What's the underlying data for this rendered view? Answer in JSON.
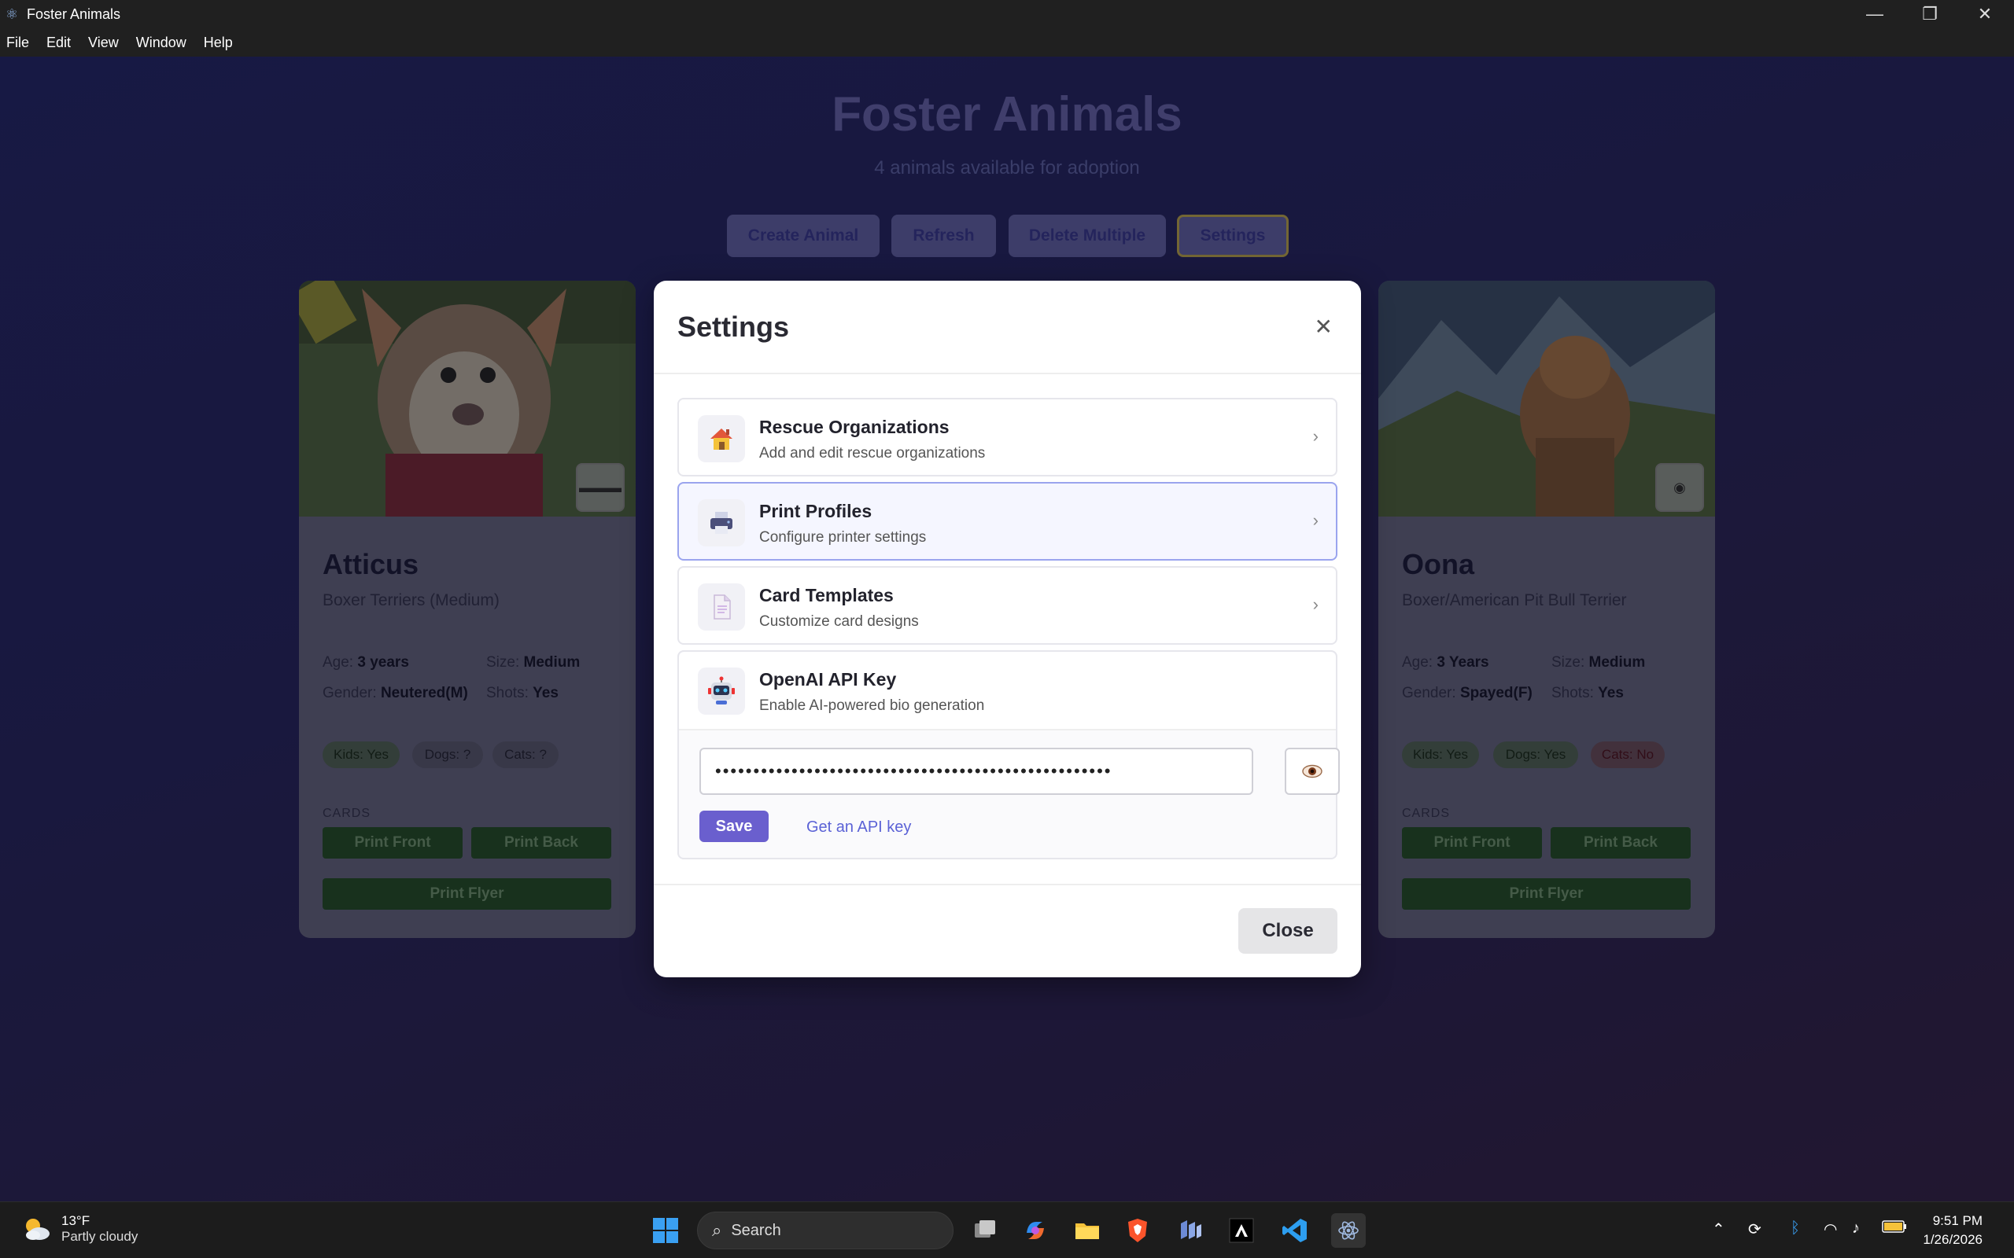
{
  "window": {
    "title": "Foster Animals",
    "menu": [
      "File",
      "Edit",
      "View",
      "Window",
      "Help"
    ]
  },
  "header": {
    "title": "Foster Animals",
    "subtitle": "4 animals available for adoption"
  },
  "toolbar": {
    "create": "Create Animal",
    "refresh": "Refresh",
    "delete_multiple": "Delete Multiple",
    "settings": "Settings"
  },
  "cards": [
    {
      "name": "Atticus",
      "breed": "Boxer Terriers (Medium)",
      "age_label": "Age:",
      "age": "3 years",
      "size_label": "Size:",
      "size": "Medium",
      "gender_label": "Gender:",
      "gender": "Neutered(M)",
      "shots_label": "Shots:",
      "shots": "Yes",
      "kids": "Kids: Yes",
      "dogs": "Dogs: ?",
      "cats": "Cats: ?",
      "cards_label": "CARDS",
      "print_front": "Print Front",
      "print_back": "Print Back",
      "print_flyer": "Print Flyer"
    },
    {
      "name": "Oona",
      "breed": "Boxer/American Pit Bull Terrier",
      "age_label": "Age:",
      "age": "3 Years",
      "size_label": "Size:",
      "size": "Medium",
      "gender_label": "Gender:",
      "gender": "Spayed(F)",
      "shots_label": "Shots:",
      "shots": "Yes",
      "kids": "Kids: Yes",
      "dogs": "Dogs: Yes",
      "cats": "Cats: No",
      "cards_label": "CARDS",
      "print_front": "Print Front",
      "print_back": "Print Back",
      "print_flyer": "Print Flyer"
    }
  ],
  "modal": {
    "title": "Settings",
    "items": [
      {
        "title": "Rescue Organizations",
        "desc": "Add and edit rescue organizations",
        "icon": "house-icon"
      },
      {
        "title": "Print Profiles",
        "desc": "Configure printer settings",
        "icon": "printer-icon"
      },
      {
        "title": "Card Templates",
        "desc": "Customize card designs",
        "icon": "document-icon"
      },
      {
        "title": "OpenAI API Key",
        "desc": "Enable AI-powered bio generation",
        "icon": "robot-icon"
      }
    ],
    "api_key_masked": "••••••••••••••••••••••••••••••••••••••••••••••••••••",
    "save": "Save",
    "get_key": "Get an API key",
    "close": "Close"
  },
  "taskbar": {
    "temp": "13°F",
    "condition": "Partly cloudy",
    "search": "Search",
    "time": "9:51 PM",
    "date": "1/26/2026"
  },
  "colors": {
    "accent": "#6a5fce",
    "link": "#5b62d6",
    "print_green": "#1c3a1e"
  }
}
